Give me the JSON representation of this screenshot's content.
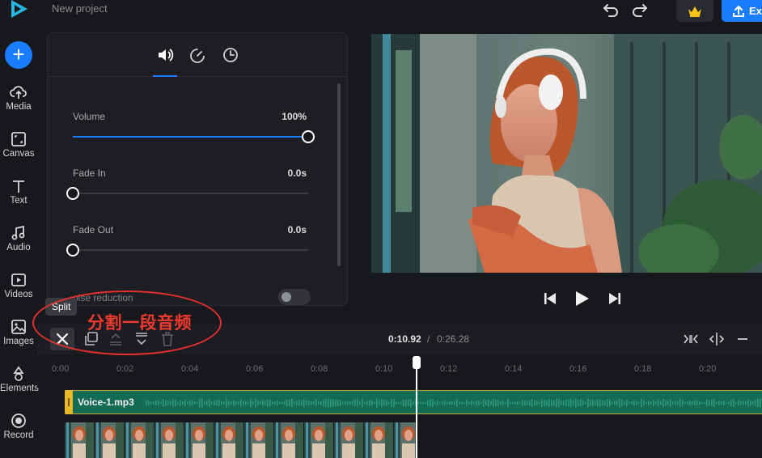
{
  "app": {
    "project_title": "New project",
    "export_label": "Ex"
  },
  "rail": {
    "items": [
      {
        "label": "Media",
        "icon": "upload-cloud-icon"
      },
      {
        "label": "Canvas",
        "icon": "canvas-icon"
      },
      {
        "label": "Text",
        "icon": "text-icon"
      },
      {
        "label": "Audio",
        "icon": "music-note-icon"
      },
      {
        "label": "Videos",
        "icon": "video-play-icon"
      },
      {
        "label": "Images",
        "icon": "image-icon"
      },
      {
        "label": "Elements",
        "icon": "elements-shapes-icon"
      },
      {
        "label": "Record",
        "icon": "record-icon"
      }
    ]
  },
  "panel": {
    "tabs": [
      "speaker-volume-icon",
      "speed-gauge-icon",
      "clock-icon"
    ],
    "active_tab": 0,
    "volume": {
      "label": "Volume",
      "value": "100%",
      "level": 1.0
    },
    "fade_in": {
      "label": "Fade In",
      "value": "0.0s",
      "level": 0.0
    },
    "fade_out": {
      "label": "Fade Out",
      "value": "0.0s",
      "level": 0.0
    },
    "noise_reduction": {
      "label": "oise reduction",
      "enabled": false
    }
  },
  "timeline": {
    "tooltip": "Split",
    "annotation": "分割一段音频",
    "current_time": "0:10.92",
    "separator": "/",
    "total_time": "0:26.28",
    "ruler_ticks": [
      "0:00",
      "0:02",
      "0:04",
      "0:06",
      "0:08",
      "0:10",
      "0:12",
      "0:14",
      "0:16",
      "0:18",
      "0:20"
    ],
    "audio_clip": "Voice-1.mp3",
    "playhead_time": "0:10.92"
  },
  "colors": {
    "accent": "#1a7cff",
    "background": "#17181c",
    "panel": "#1d1e23",
    "audio_track": "#136b54",
    "annotation": "#e53030",
    "premium_crown": "#f5c518"
  }
}
